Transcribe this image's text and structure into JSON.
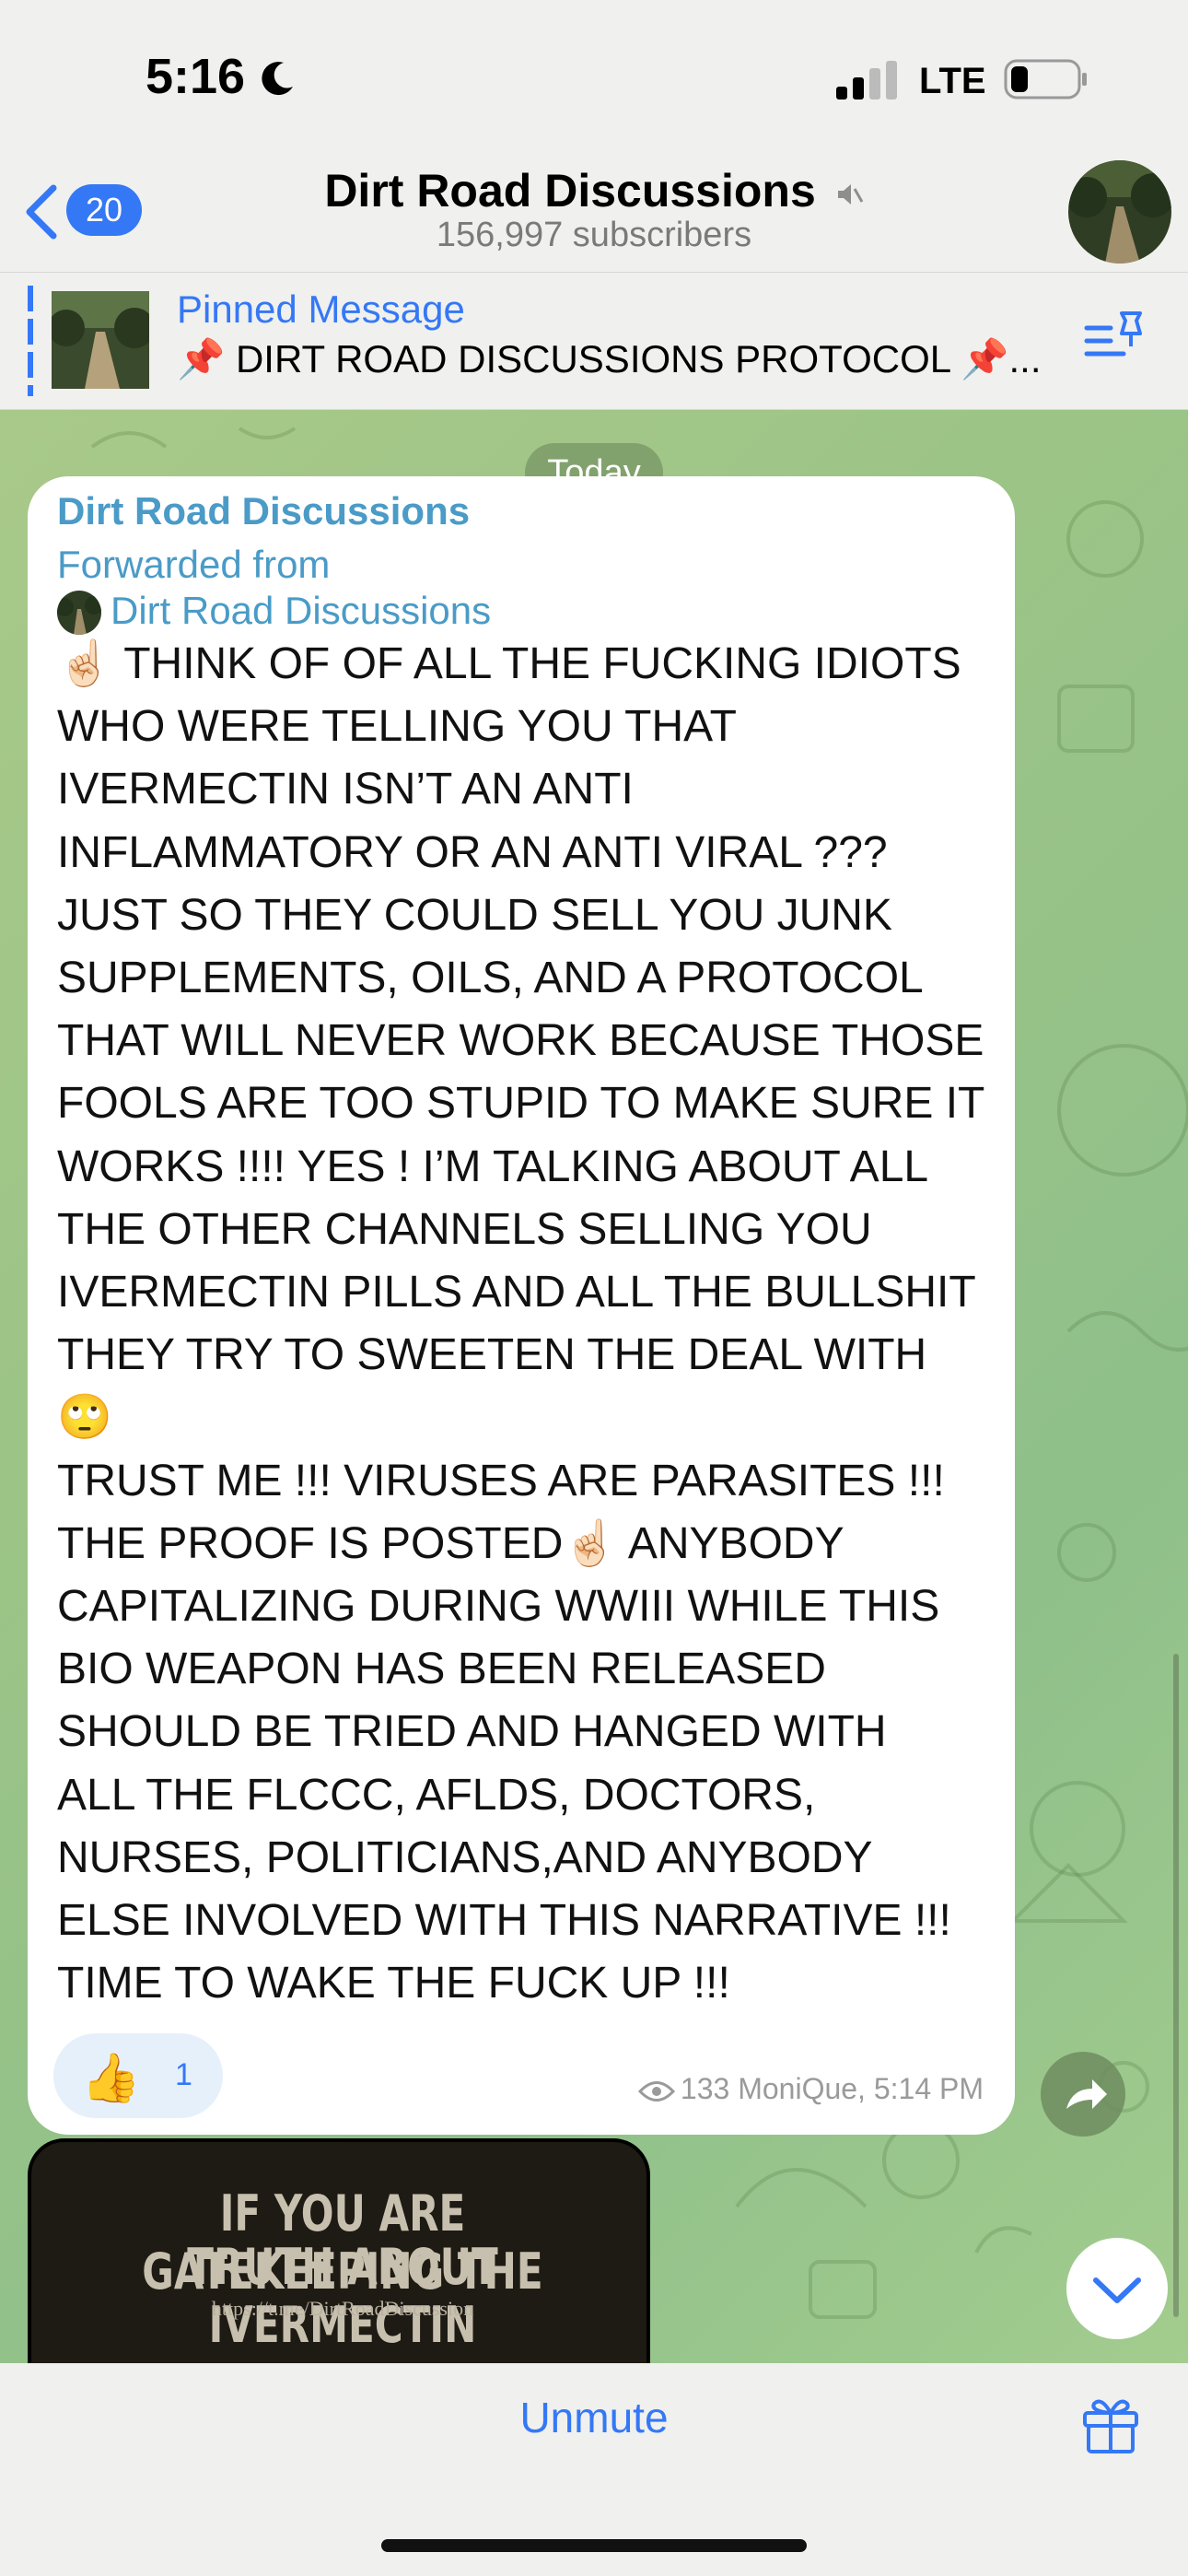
{
  "status_bar": {
    "time": "5:16",
    "network": "LTE"
  },
  "header": {
    "back_count": "20",
    "title": "Dirt Road Discussions",
    "subscribers": "156,997 subscribers"
  },
  "pinned": {
    "title": "Pinned Message",
    "text": "📌 DIRT ROAD DISCUSSIONS PROTOCOL 📌..."
  },
  "chat": {
    "date": "Today",
    "message": {
      "sender": "Dirt Road Discussions",
      "forwarded_label": "Forwarded from",
      "forwarded_name": "Dirt Road Discussions",
      "text": "☝🏻 THINK OF OF ALL THE FUCKING IDIOTS\nWHO WERE TELLING YOU THAT\nIVERMECTIN ISN’T AN ANTI\nINFLAMMATORY OR AN ANTI VIRAL ???\nJUST SO THEY COULD SELL YOU JUNK\nSUPPLEMENTS, OILS, AND A PROTOCOL\nTHAT WILL NEVER WORK BECAUSE THOSE\nFOOLS ARE TOO STUPID TO MAKE SURE IT\nWORKS !!!! YES ! I’M TALKING ABOUT ALL\nTHE OTHER CHANNELS SELLING YOU\nIVERMECTIN PILLS AND ALL THE BULLSHIT\nTHEY TRY TO SWEETEN THE DEAL WITH\n🙄\nTRUST ME !!! VIRUSES ARE PARASITES !!!\nTHE PROOF IS POSTED☝🏻 ANYBODY\nCAPITALIZING DURING WWIII WHILE THIS\nBIO WEAPON HAS BEEN RELEASED\nSHOULD BE TRIED AND HANGED WITH\nALL THE FLCCC, AFLDS, DOCTORS,\nNURSES, POLITICIANS,AND ANYBODY\nELSE INVOLVED WITH THIS NARRATIVE !!!\nTIME TO WAKE THE FUCK UP !!!",
      "reaction_emoji": "👍",
      "reaction_count": "1",
      "views": "133",
      "author_time": "MoniQue, 5:14 PM"
    },
    "next_image": {
      "line1": "IF YOU ARE GATEKEEPING THE",
      "line2": "TRUTH ABOUT IVERMECTIN",
      "url": "https://t.me/DirtRoadDiscussion"
    }
  },
  "bottom_bar": {
    "unmute_label": "Unmute"
  },
  "colors": {
    "accent": "#3478f6",
    "sender_name": "#4a9bc7",
    "chat_bg": "#9cc487"
  }
}
